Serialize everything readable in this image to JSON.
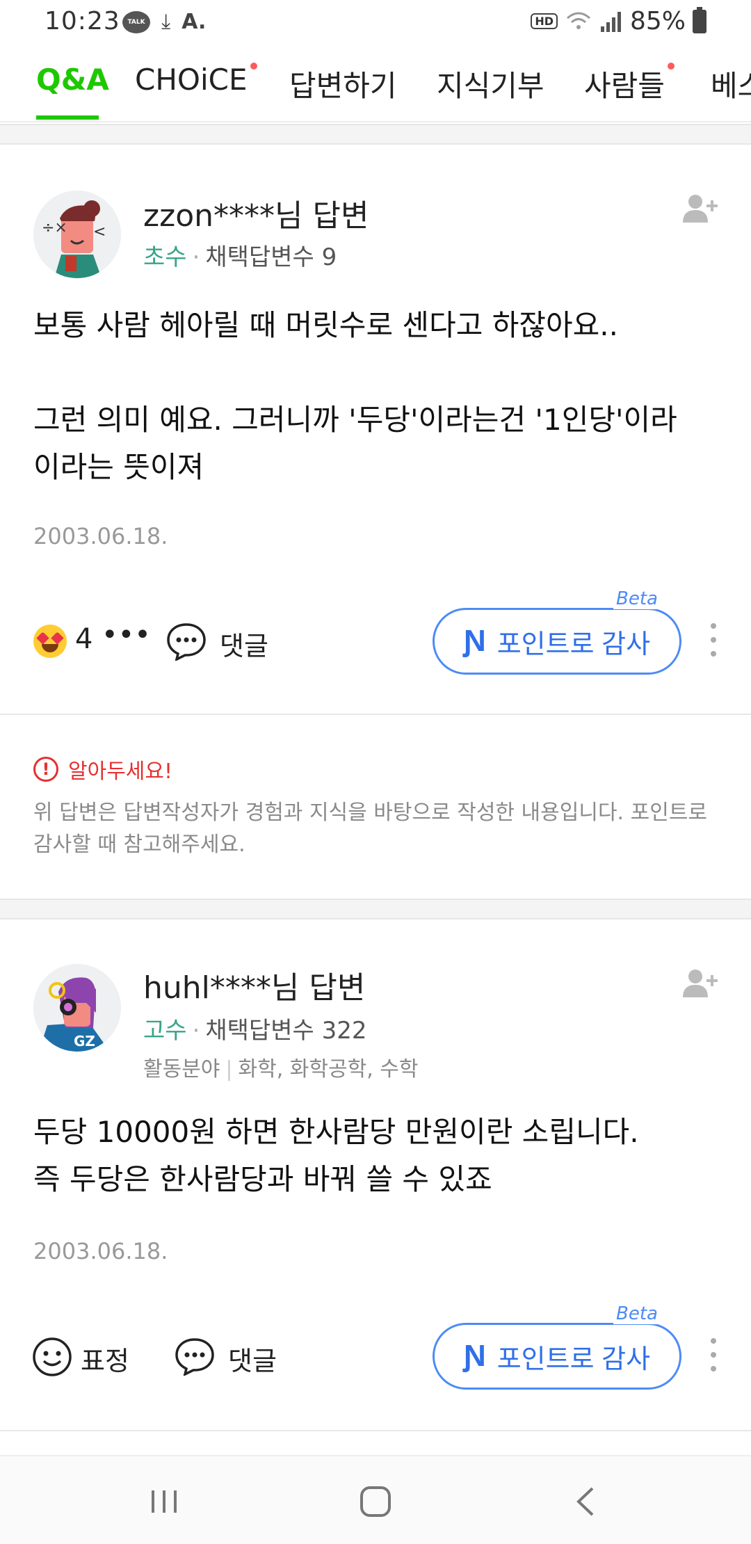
{
  "status_bar": {
    "time": "10:23",
    "talk_label": "TALK",
    "download_icon": "download-icon",
    "a_icon": "A.",
    "hd_label": "HD",
    "battery": "85%"
  },
  "tabs": [
    {
      "label": "Q&A",
      "active": true,
      "dot": false
    },
    {
      "label": "CHOiCE",
      "active": false,
      "dot": true
    },
    {
      "label": "답변하기",
      "active": false,
      "dot": false
    },
    {
      "label": "지식기부",
      "active": false,
      "dot": false
    },
    {
      "label": "사람들",
      "active": false,
      "dot": true
    },
    {
      "label": "베스",
      "active": false,
      "dot": false
    }
  ],
  "answers": [
    {
      "author": "zzon****님 답변",
      "grade": "초수",
      "adopted": "채택답변수 9",
      "body_line1": "보통 사람 헤아릴 때 머릿수로 센다고 하잖아요..",
      "body_line2": "그런 의미 예요. 그러니까 '두당'이라는건 '1인당'이라",
      "body_line3": "이라는 뜻이져",
      "date": "2003.06.18.",
      "reaction_count": "4",
      "more": "•••",
      "comment_label": "댓글",
      "thanks_label": "포인트로 감사",
      "beta_label": "Beta"
    },
    {
      "author": "huhl****님 답변",
      "grade": "고수",
      "adopted": "채택답변수 322",
      "field_label": "활동분야",
      "field_values": "화학, 화학공학, 수학",
      "body_line1": "두당 10000원 하면 한사람당 만원이란 소립니다.",
      "body_line2": "즉 두당은 한사람당과 바꿔 쓸 수 있죠",
      "date": "2003.06.18.",
      "emotion_label": "표정",
      "comment_label": "댓글",
      "thanks_label": "포인트로 감사",
      "beta_label": "Beta"
    }
  ],
  "notice": {
    "title": "알아두세요!",
    "text": "위 답변은 답변작성자가 경험과 지식을 바탕으로 작성한 내용입니다. 포인트로 감사할 때 참고해주세요."
  },
  "colors": {
    "accent_green": "#1ec800",
    "grade_green": "#38a387",
    "thanks_blue": "#2f6fe8",
    "warning_red": "#e5302f"
  }
}
